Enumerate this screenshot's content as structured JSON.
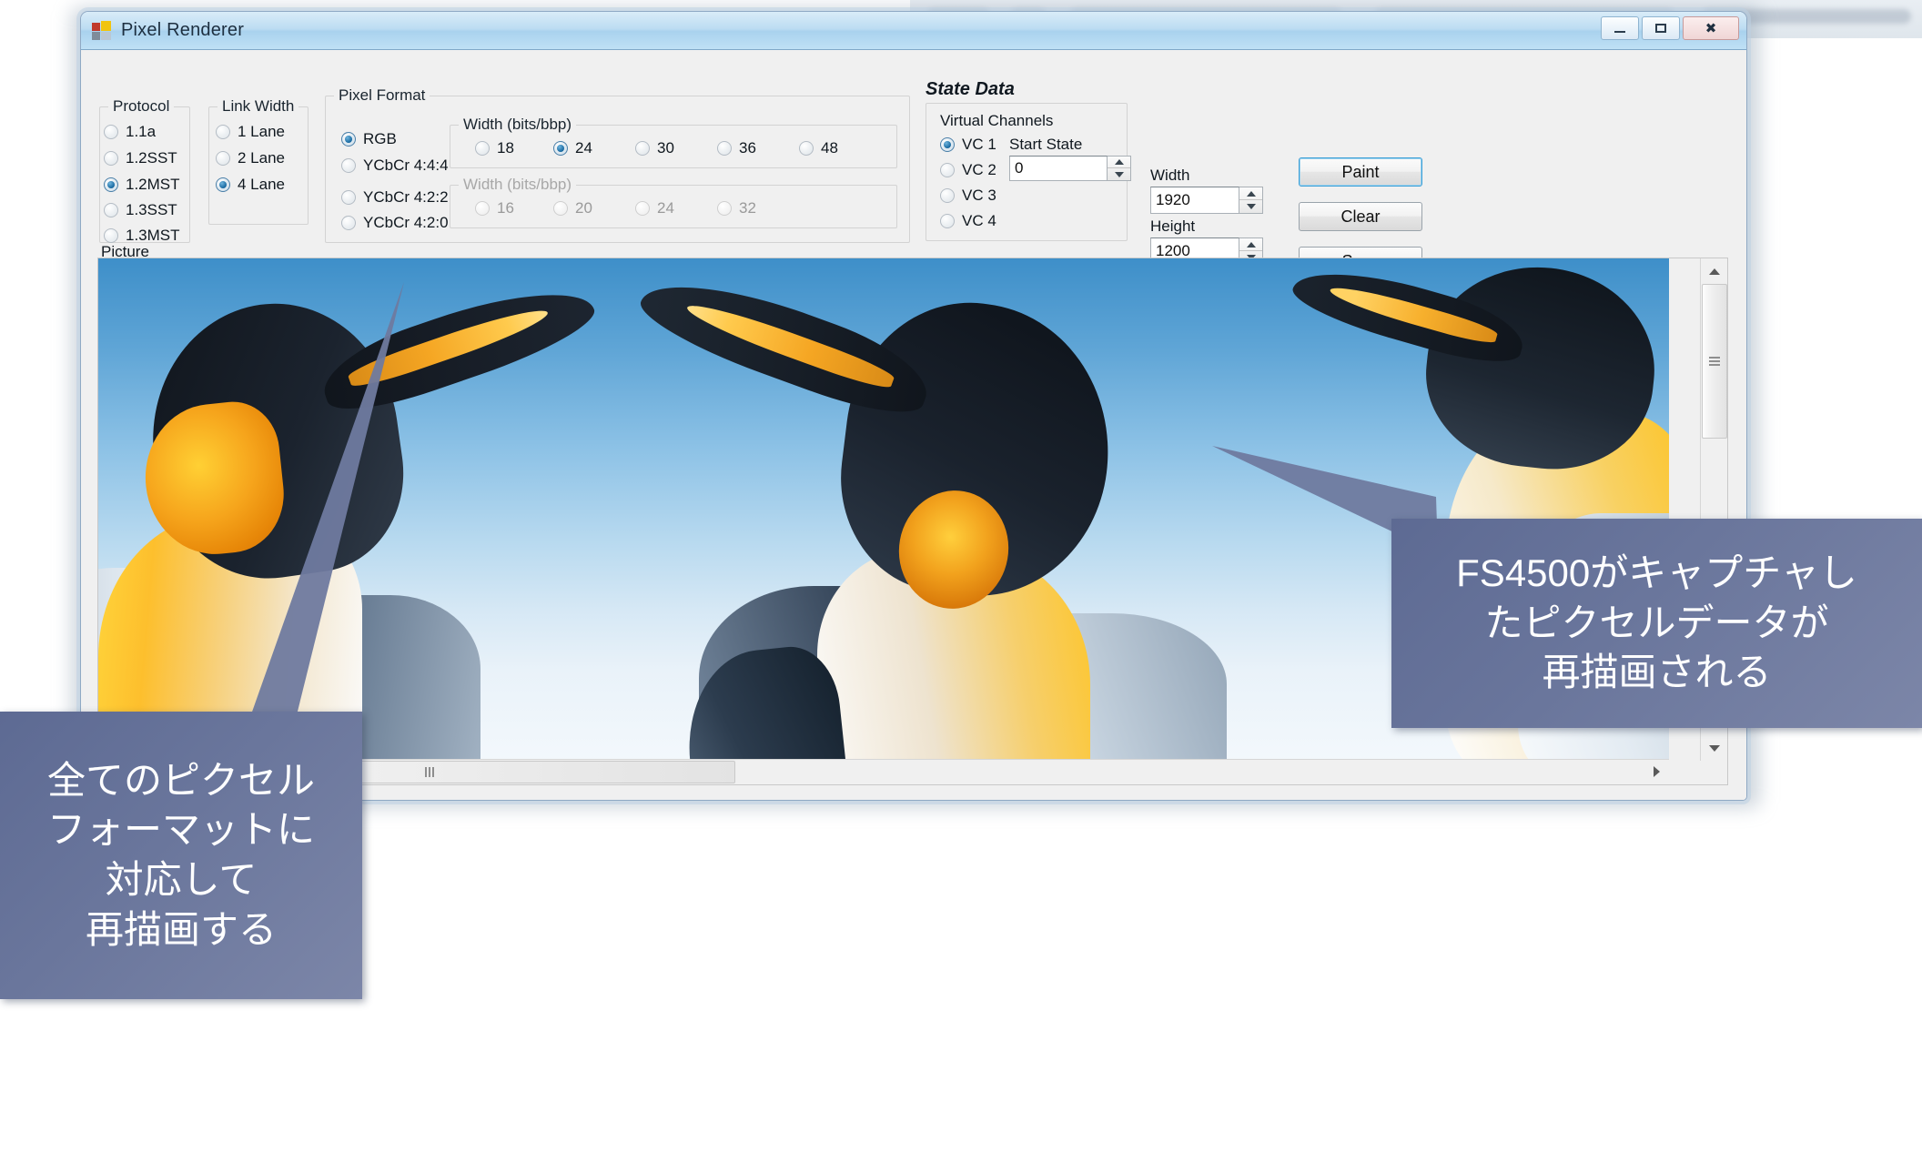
{
  "window": {
    "title": "Pixel Renderer",
    "icon": "app-icon",
    "buttons": {
      "minimize": "minimize",
      "maximize": "maximize",
      "close": "close"
    }
  },
  "protocol": {
    "legend": "Protocol",
    "options": [
      "1.1a",
      "1.2SST",
      "1.2MST",
      "1.3SST",
      "1.3MST"
    ],
    "selected": "1.2MST"
  },
  "link_width": {
    "legend": "Link Width",
    "options": [
      "1 Lane",
      "2 Lane",
      "4 Lane"
    ],
    "selected": "4 Lane"
  },
  "pixel_format": {
    "legend": "Pixel Format",
    "options": [
      "RGB",
      "YCbCr 4:4:4",
      "YCbCr 4:2:2",
      "YCbCr 4:2:0"
    ],
    "selected": "RGB",
    "width_rgb": {
      "legend": "Width (bits/bbp)",
      "options": [
        "18",
        "24",
        "30",
        "36",
        "48"
      ],
      "selected": "24",
      "enabled": true
    },
    "width_ycbcr": {
      "legend": "Width (bits/bbp)",
      "options": [
        "16",
        "20",
        "24",
        "32"
      ],
      "selected": "",
      "enabled": false
    }
  },
  "state_data": {
    "title": "State Data",
    "virtual_channels": {
      "legend": "Virtual Channels",
      "options": [
        "VC 1",
        "VC 2",
        "VC 3",
        "VC 4"
      ],
      "selected": "VC 1"
    },
    "start_state": {
      "label": "Start State",
      "value": "0"
    }
  },
  "dimensions": {
    "width": {
      "label": "Width",
      "value": "1920"
    },
    "height": {
      "label": "Height",
      "value": "1200"
    }
  },
  "actions": {
    "paint": "Paint",
    "clear": "Clear",
    "save": "Save"
  },
  "picture": {
    "legend": "Picture",
    "scroll_v": "vertical-scrollbar",
    "scroll_h": "horizontal-scrollbar"
  },
  "callouts": {
    "left": "全てのピクセル\nフォーマットに\n対応して\n再描画する",
    "right": "FS4500がキャプチャし\nたピクセルデータが\n再描画される"
  },
  "colors": {
    "callout_fill": "#6a769c",
    "accent_blue": "#1668a0",
    "window_chrome": "#bcdcf2",
    "client_bg": "#f0f0f0"
  }
}
